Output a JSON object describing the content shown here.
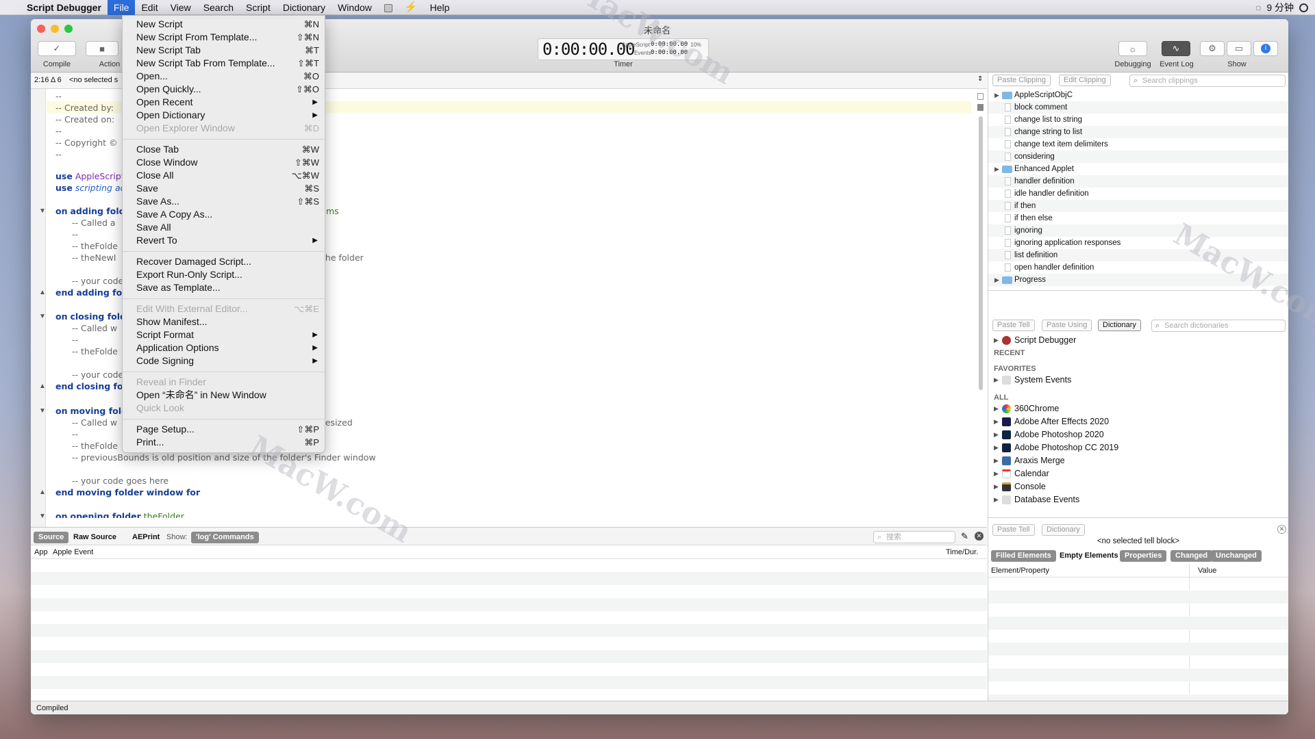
{
  "menubar": {
    "app": "Script Debugger",
    "items": [
      "File",
      "Edit",
      "View",
      "Search",
      "Script",
      "Dictionary",
      "Window",
      "Help"
    ],
    "clock": "9 分钟"
  },
  "window": {
    "title": "未命名"
  },
  "toolbar": {
    "compile": "Compile",
    "action": "Action",
    "timer_label": "Timer",
    "timer_value": "0:00:00.00",
    "as_label": "AppleScript",
    "as_value": "0:00:00.00",
    "ev_label": "Events",
    "ev_value": "0:00:00.00",
    "pct": "10%",
    "debugging": "Debugging",
    "event_log": "Event Log",
    "show": "Show"
  },
  "strip": {
    "pos": "2:16 Δ 6",
    "sel": "<no selected s"
  },
  "code": {
    "l1": "--",
    "l2": "--  Created by:",
    "l3": "--  Created on:",
    "l4": "--",
    "l5": "--  Copyright ©",
    "l6": "--",
    "use1a": "use",
    "use1b": "AppleScript",
    "use2a": "use",
    "use2b": "scripting ad",
    "on1a": "on",
    "on1b": "adding fold",
    "on1c": "ms",
    "c1": "--  Called a",
    "c2": "--",
    "c3": "--  theFolde",
    "c4": "--  theNewI",
    "c4b": "the folder",
    "yc1": "-- your code",
    "end1a": "end",
    "end1b": "adding fol",
    "on2a": "on",
    "on2b": "closing fold",
    "c5": "--  Called w",
    "c6": "--",
    "c7": "--  theFolde",
    "yc2": "-- your code",
    "end2a": "end",
    "end2b": "closing fo",
    "on3a": "on",
    "on3b": "moving fold",
    "c8": "--  Called w",
    "c8b": "resized",
    "c9": "--",
    "c10": "--  theFolde",
    "c11": "--  previousBounds is old position and size of the folder's Finder window",
    "yc3": "-- your code goes here",
    "end3a": "end",
    "end3b": "moving folder window for",
    "on4a": "on",
    "on4b": "opening folder",
    "on4c": "theFolder"
  },
  "menu": {
    "items": [
      {
        "label": "New Script",
        "shortcut": "⌘N"
      },
      {
        "label": "New Script From Template...",
        "shortcut": "⇧⌘N"
      },
      {
        "label": "New Script Tab",
        "shortcut": "⌘T"
      },
      {
        "label": "New Script Tab From Template...",
        "shortcut": "⇧⌘T"
      },
      {
        "label": "Open...",
        "shortcut": "⌘O"
      },
      {
        "label": "Open Quickly...",
        "shortcut": "⇧⌘O"
      },
      {
        "label": "Open Recent",
        "shortcut": ""
      },
      {
        "label": "Open Dictionary",
        "shortcut": ""
      },
      {
        "label": "Open Explorer Window",
        "shortcut": "⌘D"
      },
      {
        "label": "Close Tab",
        "shortcut": "⌘W"
      },
      {
        "label": "Close Window",
        "shortcut": "⇧⌘W"
      },
      {
        "label": "Close All",
        "shortcut": "⌥⌘W"
      },
      {
        "label": "Save",
        "shortcut": "⌘S"
      },
      {
        "label": "Save As...",
        "shortcut": "⇧⌘S"
      },
      {
        "label": "Save A Copy As...",
        "shortcut": ""
      },
      {
        "label": "Save All",
        "shortcut": ""
      },
      {
        "label": "Revert To",
        "shortcut": ""
      },
      {
        "label": "Recover Damaged Script...",
        "shortcut": ""
      },
      {
        "label": "Export Run-Only Script...",
        "shortcut": ""
      },
      {
        "label": "Save as Template...",
        "shortcut": ""
      },
      {
        "label": "Edit With External Editor...",
        "shortcut": "⌥⌘E"
      },
      {
        "label": "Show Manifest...",
        "shortcut": ""
      },
      {
        "label": "Script Format",
        "shortcut": ""
      },
      {
        "label": "Application Options",
        "shortcut": ""
      },
      {
        "label": "Code Signing",
        "shortcut": ""
      },
      {
        "label": "Reveal in Finder",
        "shortcut": ""
      },
      {
        "label": "Open “未命名” in New Window",
        "shortcut": ""
      },
      {
        "label": "Quick Look",
        "shortcut": ""
      },
      {
        "label": "Page Setup...",
        "shortcut": "⇧⌘P"
      },
      {
        "label": "Print...",
        "shortcut": "⌘P"
      }
    ]
  },
  "clippings": {
    "paste": "Paste Clipping",
    "edit": "Edit Clipping",
    "search": "Search clippings",
    "items": [
      "AppleScriptObjC",
      "block comment",
      "change list to string",
      "change string to list",
      "change text item delimiters",
      "considering",
      "Enhanced Applet",
      "handler definition",
      "idle handler definition",
      "if then",
      "if then else",
      "ignoring",
      "ignoring application responses",
      "list definition",
      "open handler definition",
      "Progress"
    ]
  },
  "dictionary": {
    "paste_tell": "Paste Tell",
    "paste_using": "Paste Using",
    "dictionary_btn": "Dictionary",
    "search": "Search dictionaries",
    "top": "Script Debugger",
    "recent": "RECENT",
    "favorites": "FAVORITES",
    "fav_item": "System Events",
    "all": "ALL",
    "apps": [
      "360Chrome",
      "Adobe After Effects 2020",
      "Adobe Photoshop 2020",
      "Adobe Photoshop CC 2019",
      "Araxis Merge",
      "Calendar",
      "Console",
      "Database Events"
    ]
  },
  "explorer": {
    "paste_tell": "Paste Tell",
    "dictionary_btn": "Dictionary",
    "no_tell": "<no selected tell block>",
    "tabs": [
      "Filled Elements",
      "Empty Elements",
      "Properties",
      "Changed",
      "Unchanged"
    ],
    "col1": "Element/Property",
    "col2": "Value"
  },
  "log": {
    "source": "Source",
    "raw": "Raw Source",
    "aeprint": "AEPrint",
    "show": "Show:",
    "log_cmd": "'log' Commands",
    "search": "搜索",
    "col_app": "App",
    "col_event": "Apple Event",
    "col_time": "Time/Dur."
  },
  "status": {
    "text": "Compiled"
  },
  "watermark": "MacW.com"
}
